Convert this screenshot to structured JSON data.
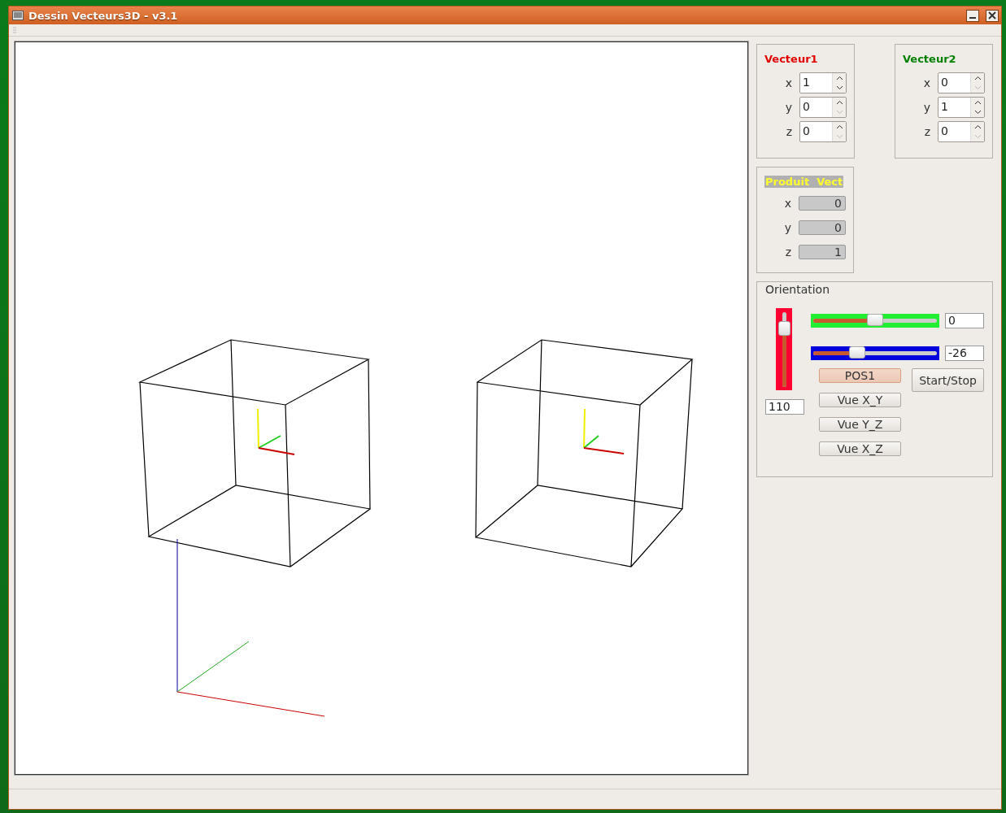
{
  "window": {
    "title": "Dessin Vecteurs3D - v3.1"
  },
  "vectors": [
    {
      "title": "Vecteur1",
      "color": "#e00000",
      "fields": [
        {
          "label": "x",
          "value": "1",
          "down_disabled": false
        },
        {
          "label": "y",
          "value": "0",
          "down_disabled": true
        },
        {
          "label": "z",
          "value": "0",
          "down_disabled": true
        }
      ]
    },
    {
      "title": "Vecteur2",
      "color": "#008000",
      "fields": [
        {
          "label": "x",
          "value": "0",
          "down_disabled": true
        },
        {
          "label": "y",
          "value": "1",
          "down_disabled": false
        },
        {
          "label": "z",
          "value": "0",
          "down_disabled": true
        }
      ]
    }
  ],
  "product": {
    "title": "Produit  Vect",
    "fields": [
      {
        "label": "x",
        "value": "0"
      },
      {
        "label": "y",
        "value": "0"
      },
      {
        "label": "z",
        "value": "1"
      }
    ]
  },
  "orientation": {
    "title": "Orientation",
    "vertical_slider": {
      "level": 0.85,
      "color": "#ff0033",
      "value": "110"
    },
    "sliders": [
      {
        "level": 0.53,
        "color": "#22ee33",
        "value": "0"
      },
      {
        "level": 0.39,
        "color": "#0000dd",
        "value": "-26"
      }
    ],
    "buttons": [
      {
        "label": "POS1",
        "highlighted": true
      },
      {
        "label": "Vue X_Y",
        "highlighted": false
      },
      {
        "label": "Vue Y_Z",
        "highlighted": false
      },
      {
        "label": "Vue X_Z",
        "highlighted": false
      }
    ],
    "start_stop": "Start/Stop"
  }
}
